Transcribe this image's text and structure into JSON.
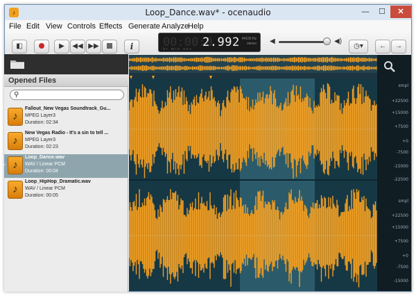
{
  "window": {
    "title": "Loop_Dance.wav* - ocenaudio"
  },
  "menu": [
    "File",
    "Edit",
    "View",
    "Controls",
    "Effects",
    "Generate",
    "Analyze",
    "Help"
  ],
  "display": {
    "time": "2.992",
    "time_dim": "00:00:0",
    "units": "hr  min  sec",
    "sample_rate": "44100 Hz",
    "channels": "stereo"
  },
  "sidebar": {
    "title": "Opened Files",
    "files": [
      {
        "name": "Fallout_New Vegas Soundtrack_Gu...",
        "format": "MPEG Layer3",
        "duration": "Duration: 02:34"
      },
      {
        "name": "New Vegas Radio - It's a sin to tell ...",
        "format": "MPEG Layer3",
        "duration": "Duration: 02:23"
      },
      {
        "name": "Loop_Dance.wav",
        "format": "WAV / Linear PCM",
        "duration": "Duration: 00:04"
      },
      {
        "name": "Loop_HipHop_Dramatic.wav",
        "format": "WAV / Linear PCM",
        "duration": "Duration: 00:05"
      }
    ],
    "selected_index": 2
  },
  "ruler": {
    "top": [
      "smpl",
      "+22500",
      "+15000",
      "+7500",
      "+0",
      "-7500",
      "-15000",
      "-22500"
    ],
    "bottom": [
      "smpl",
      "+22500",
      "+15000",
      "+7500",
      "+0",
      "-7500",
      "-15000"
    ]
  },
  "colors": {
    "waveform": "#f5a021",
    "background": "#163845",
    "selection": "#2b5b6a"
  }
}
